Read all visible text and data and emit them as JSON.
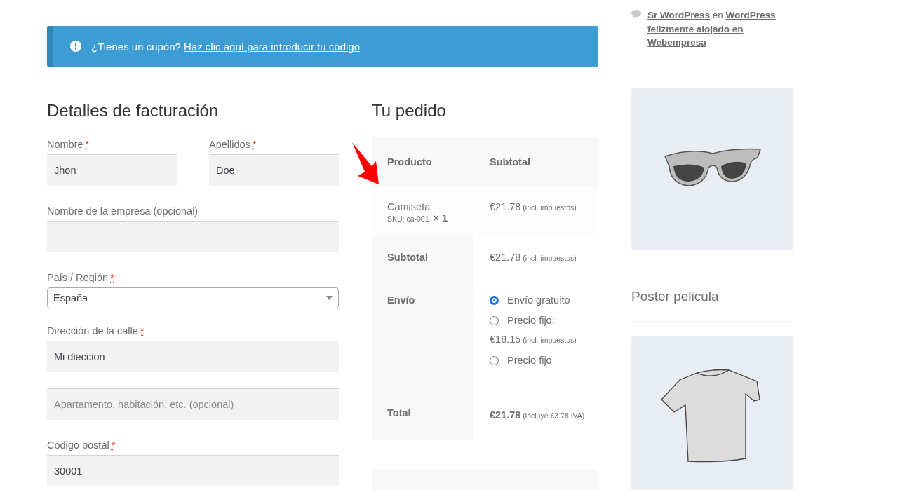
{
  "notice": {
    "text": "¿Tienes un cupón?",
    "link": "Haz clic aquí para introducir tu código"
  },
  "billing": {
    "title": "Detalles de facturación",
    "name_fields": [
      {
        "kind": "text",
        "label": "Nombre",
        "required_mark": "*",
        "value": "Jhon"
      },
      {
        "kind": "text",
        "label": "Apellidos",
        "required_mark": "*",
        "value": "Doe"
      }
    ],
    "fields": [
      {
        "kind": "text",
        "label": "Nombre de la empresa (opcional)"
      },
      {
        "kind": "select",
        "label": "País / Región",
        "required_mark": "*",
        "value": "España"
      },
      {
        "kind": "text",
        "label": "Dirección de la calle",
        "required_mark": "*",
        "value": "Mi dieccion"
      },
      {
        "kind": "text",
        "placeholder": "Apartamento, habitación, etc. (opcional)"
      },
      {
        "kind": "text",
        "label": "Código postal",
        "required_mark": "*",
        "value": "30001"
      }
    ]
  },
  "order": {
    "title": "Tu pedido",
    "columns": [
      "Producto",
      "Subtotal"
    ],
    "items": [
      {
        "name": "Camiseta",
        "sku": "SKU: ca-001",
        "quantity": "× 1",
        "price": "€21.78",
        "note": "(incl. impuestos)"
      }
    ],
    "subtotal": {
      "label": "Subtotal",
      "price": "€21.78",
      "note": "(incl. impuestos)"
    },
    "shipping": {
      "label": "Envío",
      "options": [
        {
          "label": "Envío gratuito",
          "selected": true
        },
        {
          "label": "Precio fijo:",
          "price": "€18.15",
          "note": "(incl. impuestos)",
          "selected": false
        },
        {
          "label": "Precio fijo",
          "selected": false
        }
      ]
    },
    "total": {
      "label": "Total",
      "price": "€21.78",
      "note": "(incluye €3.78 IVA)"
    }
  },
  "sidebar": [
    {
      "kind": "comment",
      "author": "Sr WordPress",
      "connector": "en",
      "post": "WordPress felizmente alojado en Webempresa"
    },
    {
      "kind": "sunglasses"
    },
    {
      "kind": "heading",
      "text": "Poster pelicula"
    },
    {
      "kind": "tshirt"
    }
  ]
}
